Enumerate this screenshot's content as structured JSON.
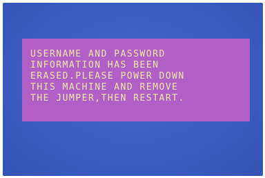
{
  "screen": {
    "background_color": "#3d5fc4"
  },
  "message": {
    "box_color": "#b15fc7",
    "text_color": "#f2e9a8",
    "lines": [
      "USERNAME AND PASSWORD",
      "INFORMATION HAS BEEN",
      "ERASED.PLEASE POWER DOWN",
      "THIS MACHINE AND REMOVE",
      "THE JUMPER,THEN RESTART."
    ]
  }
}
